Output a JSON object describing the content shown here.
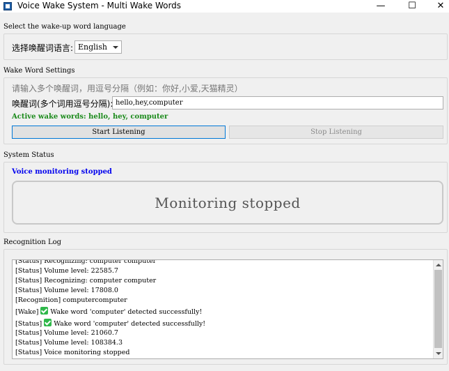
{
  "window": {
    "title": "Voice Wake System - Multi Wake Words",
    "minimize": "—",
    "maximize": "☐",
    "close": "✕"
  },
  "language": {
    "section_title": "Select the wake-up word language",
    "label": "选择唤醒词语言:",
    "selected": "English"
  },
  "wake_settings": {
    "section_title": "Wake Word Settings",
    "hint": "请输入多个唤醒词，用逗号分隔（例如：你好,小爱,天猫精灵）",
    "input_label": "唤醒词(多个词用逗号分隔):",
    "input_value": "hello,hey,computer",
    "active_words": "Active wake words: hello, hey, computer",
    "start_button": "Start Listening",
    "stop_button": "Stop Listening"
  },
  "system_status": {
    "section_title": "System Status",
    "voice_status": "Voice monitoring stopped",
    "monitor_text": "Monitoring stopped"
  },
  "log": {
    "section_title": "Recognition Log",
    "lines": [
      {
        "text": "[Status] Recognizing: computer computer"
      },
      {
        "text": "[Status] Volume level: 22585.7"
      },
      {
        "text": "[Status] Recognizing: computer computer"
      },
      {
        "text": "[Status] Volume level: 17808.0"
      },
      {
        "text": "[Recognition] computercomputer"
      },
      {
        "prefix": "[Wake]",
        "icon": "check-icon",
        "text": "Wake word 'computer' detected successfully!"
      },
      {
        "prefix": "[Status]",
        "icon": "check-icon",
        "text": "Wake word 'computer' detected successfully!"
      },
      {
        "text": "[Status] Volume level: 21060.7"
      },
      {
        "text": "[Status] Volume level: 108384.3"
      },
      {
        "text": "[Status] Voice monitoring stopped"
      }
    ]
  },
  "colors": {
    "accent": "#0078d7",
    "active_words": "#1a8a1a",
    "voice_status": "#0000ee",
    "check": "#2fb84a"
  }
}
